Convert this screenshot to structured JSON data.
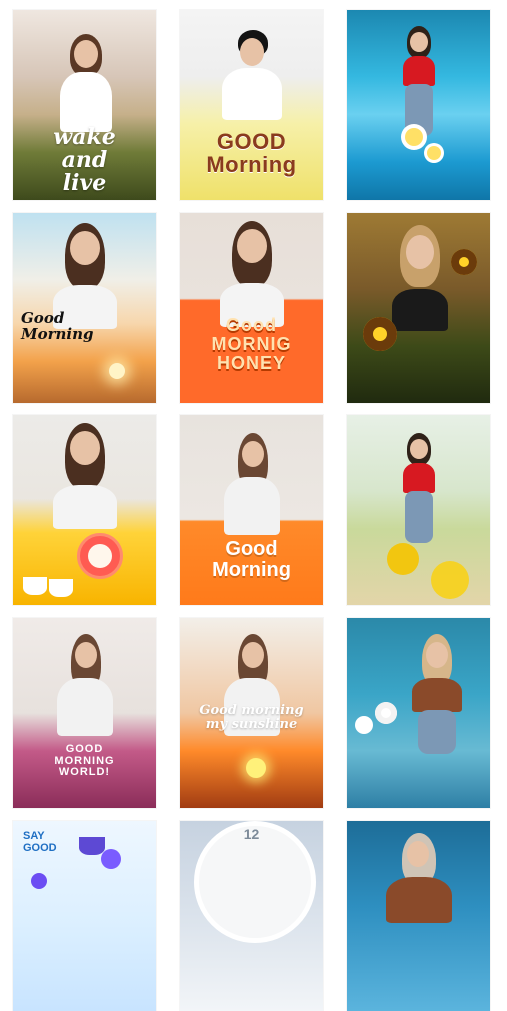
{
  "gallery": {
    "tiles": [
      {
        "id": "t1",
        "text": "wake\nand\nlive"
      },
      {
        "id": "t2",
        "text": "GOOD\nMorning"
      },
      {
        "id": "t3",
        "text": ""
      },
      {
        "id": "t4",
        "text": "Good\nMorning"
      },
      {
        "id": "t5",
        "text": "Good\nMORNIG\nHONEY"
      },
      {
        "id": "t6",
        "text": ""
      },
      {
        "id": "t7",
        "text": ""
      },
      {
        "id": "t8",
        "text": "Good\nMorning"
      },
      {
        "id": "t9",
        "text": ""
      },
      {
        "id": "t10",
        "text": "GOOD\nMORNING\nWORLD!"
      },
      {
        "id": "t11",
        "text": "Good morning\nmy sunshine"
      },
      {
        "id": "t12",
        "text": ""
      },
      {
        "id": "t13",
        "text": "SAY\nGOOD"
      },
      {
        "id": "t14",
        "text": "12"
      },
      {
        "id": "t15",
        "text": ""
      }
    ]
  },
  "colors": {
    "white": "#ffffff",
    "orange": "#ff7a1a",
    "yellow": "#ffd43a",
    "sky": "#28b1df",
    "green": "#4c5a22",
    "pink": "#c95b8a"
  }
}
